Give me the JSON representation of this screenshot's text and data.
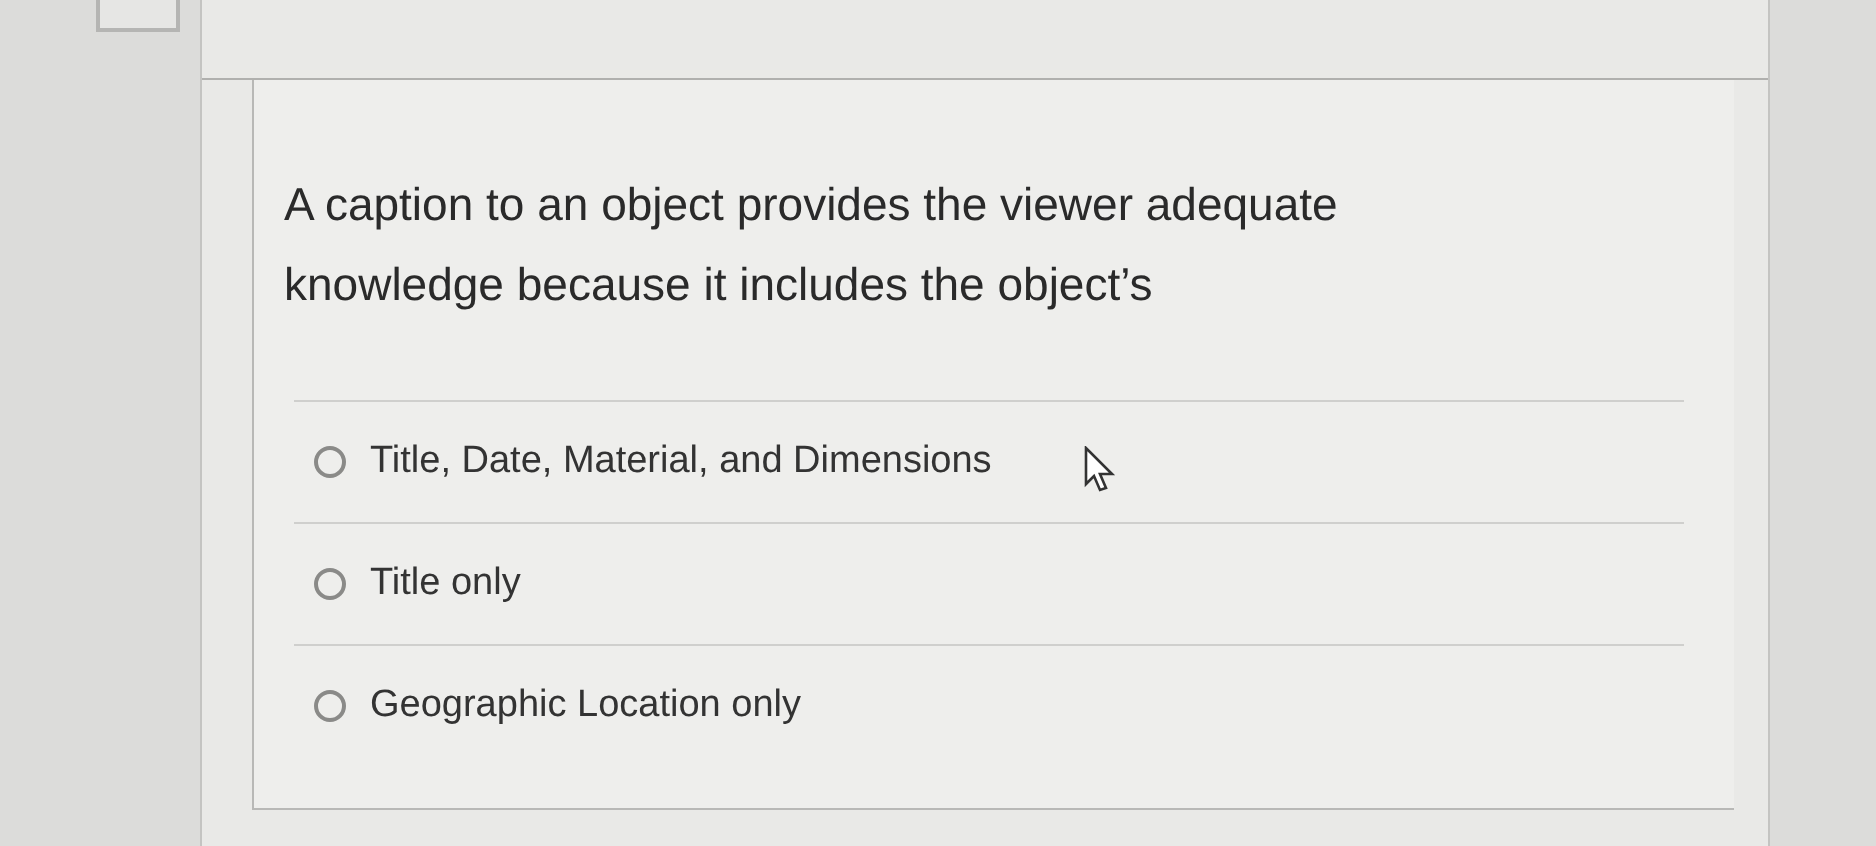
{
  "question": {
    "text": "A caption to an object provides the viewer adequate knowledge because it includes the object’s"
  },
  "options": [
    {
      "label": "Title, Date, Material, and Dimensions",
      "selected": false
    },
    {
      "label": "Title only",
      "selected": false
    },
    {
      "label": "Geographic Location only",
      "selected": false
    }
  ]
}
